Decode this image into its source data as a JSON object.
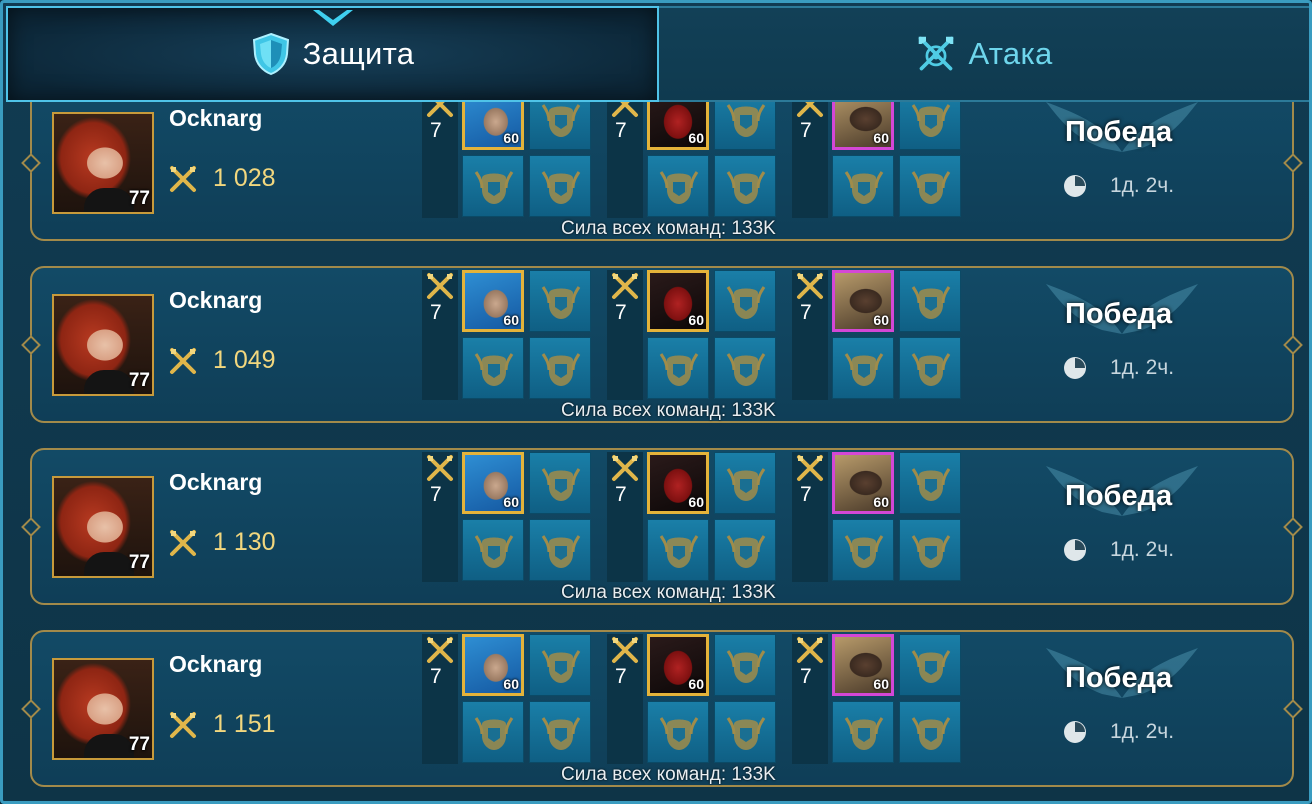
{
  "tabs": [
    {
      "label": "Защита",
      "icon": "shield-icon",
      "active": true
    },
    {
      "label": "Атака",
      "icon": "crossed-axes-target-icon",
      "active": false
    }
  ],
  "battles": [
    {
      "player": {
        "name": "Ocknarg",
        "level": "77",
        "power": "1 028",
        "avatar": "red-haired-hero-avatar"
      },
      "teams": [
        {
          "level": "7",
          "champion_level": "60",
          "champion_frame": "gold"
        },
        {
          "level": "7",
          "champion_level": "60",
          "champion_frame": "gold"
        },
        {
          "level": "7",
          "champion_level": "60",
          "champion_frame": "purple"
        }
      ],
      "team_power_label": "Сила всех команд: 133K",
      "result": "Победа",
      "time": "1д. 2ч."
    },
    {
      "player": {
        "name": "Ocknarg",
        "level": "77",
        "power": "1 049",
        "avatar": "red-haired-hero-avatar"
      },
      "teams": [
        {
          "level": "7",
          "champion_level": "60",
          "champion_frame": "gold"
        },
        {
          "level": "7",
          "champion_level": "60",
          "champion_frame": "gold"
        },
        {
          "level": "7",
          "champion_level": "60",
          "champion_frame": "purple"
        }
      ],
      "team_power_label": "Сила всех команд: 133K",
      "result": "Победа",
      "time": "1д. 2ч."
    },
    {
      "player": {
        "name": "Ocknarg",
        "level": "77",
        "power": "1 130",
        "avatar": "red-haired-hero-avatar"
      },
      "teams": [
        {
          "level": "7",
          "champion_level": "60",
          "champion_frame": "gold"
        },
        {
          "level": "7",
          "champion_level": "60",
          "champion_frame": "gold"
        },
        {
          "level": "7",
          "champion_level": "60",
          "champion_frame": "purple"
        }
      ],
      "team_power_label": "Сила всех команд: 133K",
      "result": "Победа",
      "time": "1д. 2ч."
    },
    {
      "player": {
        "name": "Ocknarg",
        "level": "77",
        "power": "1 151",
        "avatar": "red-haired-hero-avatar"
      },
      "teams": [
        {
          "level": "7",
          "champion_level": "60",
          "champion_frame": "gold"
        },
        {
          "level": "7",
          "champion_level": "60",
          "champion_frame": "gold"
        },
        {
          "level": "7",
          "champion_level": "60",
          "champion_frame": "purple"
        }
      ],
      "team_power_label": "Сила всех команд: 133K",
      "result": "Победа",
      "time": "1д. 2ч."
    }
  ],
  "colors": {
    "accent_cyan": "#4fc3e8",
    "gold_border": "#a28a4a",
    "power_text": "#f2d77e",
    "gold_frame": "#e4b33a",
    "purple_frame": "#d447d6"
  }
}
